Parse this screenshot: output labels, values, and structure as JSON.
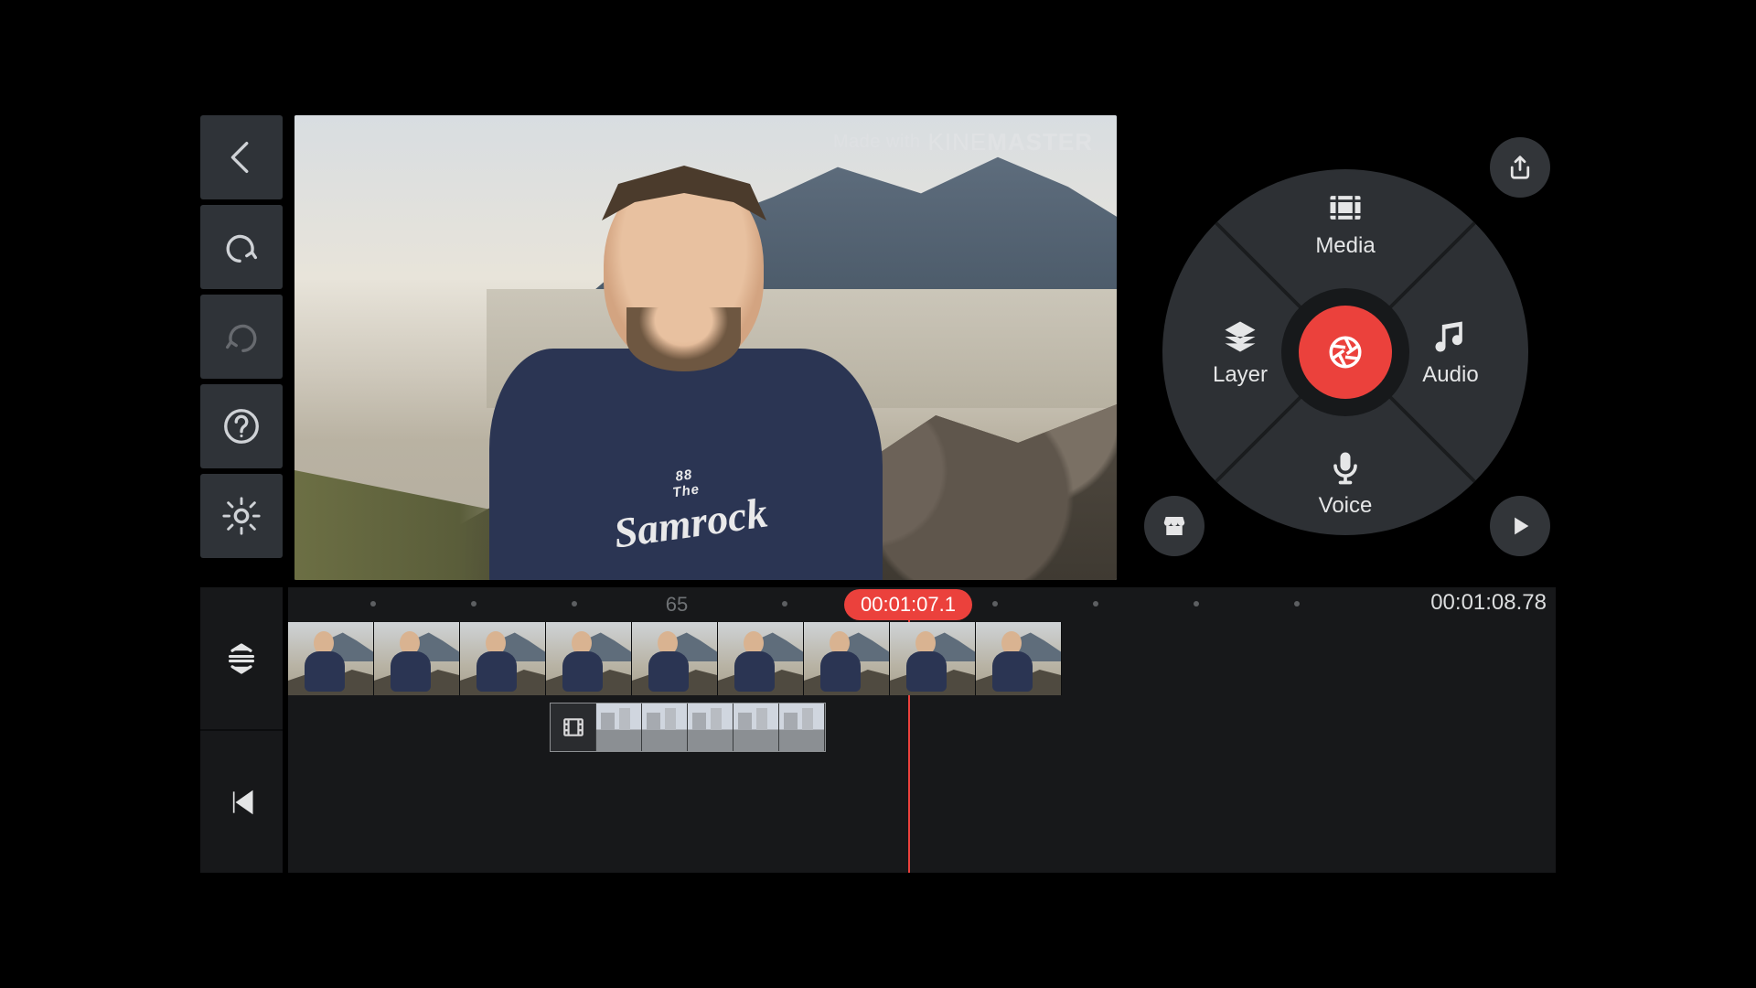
{
  "watermark": {
    "prefix": "Made with",
    "brand_a": "KINE",
    "brand_b": "MASTER"
  },
  "wheel": {
    "media": "Media",
    "layer": "Layer",
    "audio": "Audio",
    "voice": "Voice"
  },
  "timeline": {
    "ruler_label": "65",
    "playhead_time": "00:01:07.1",
    "total_time": "00:01:08.78"
  },
  "preview_shirt": {
    "line1": "88",
    "line2": "The",
    "line3": "Samrock"
  }
}
